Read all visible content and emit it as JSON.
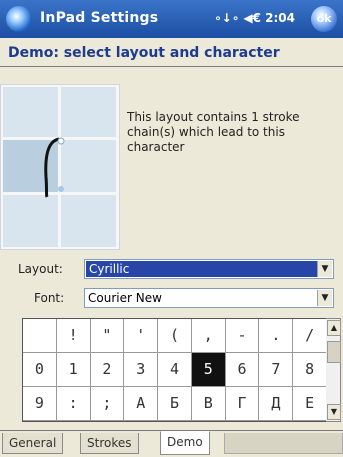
{
  "titlebar": {
    "app_title": "InPad Settings",
    "status_text": "∘↓∘ ◀€ 2:04",
    "ok_label": "ok"
  },
  "page": {
    "heading": "Demo: select layout and character",
    "description": "This layout contains 1 stroke chain(s) which lead to this character"
  },
  "form": {
    "layout_label": "Layout:",
    "layout_value": "Cyrillic",
    "font_label": "Font:",
    "font_value": "Courier New"
  },
  "char_grid": {
    "rows": [
      [
        " ",
        "!",
        "\"",
        "'",
        "(",
        ",",
        "-",
        ".",
        "/"
      ],
      [
        "0",
        "1",
        "2",
        "3",
        "4",
        "5",
        "6",
        "7",
        "8"
      ],
      [
        "9",
        ":",
        ";",
        "А",
        "Б",
        "В",
        "Г",
        "Д",
        "Е"
      ]
    ],
    "selected": "5"
  },
  "tabs": [
    {
      "label": "General",
      "active": false
    },
    {
      "label": "Strokes",
      "active": false
    },
    {
      "label": "Demo",
      "active": true
    }
  ],
  "icons": {
    "start": "windows-start-icon",
    "connectivity": "connectivity-icon",
    "volume": "volume-icon",
    "ok": "ok-button-icon"
  },
  "colors": {
    "titlebar": "#1c4fa3",
    "heading": "#1d3b8f",
    "selection": "#2846a8"
  }
}
